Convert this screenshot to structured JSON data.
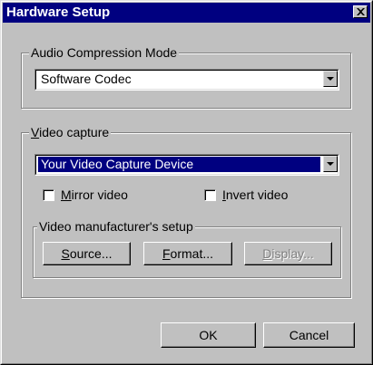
{
  "window": {
    "title": "Hardware Setup",
    "close_icon": "close-icon"
  },
  "audio": {
    "group_label": "Audio Compression Mode",
    "selected_value": "Software Codec"
  },
  "video": {
    "group_label_accel": "V",
    "group_label_rest": "ideo capture",
    "device_value": "Your Video Capture Device",
    "mirror": {
      "accel": "M",
      "rest": "irror video",
      "checked": false
    },
    "invert": {
      "accel": "I",
      "rest": "nvert video",
      "checked": false
    }
  },
  "manufacturer": {
    "group_label": "Video manufacturer's setup",
    "source": {
      "accel": "S",
      "rest": "ource..."
    },
    "format": {
      "accel": "F",
      "rest": "ormat..."
    },
    "display": {
      "accel": "D",
      "rest": "isplay...",
      "disabled": true
    }
  },
  "footer": {
    "ok_label": "OK",
    "cancel_label": "Cancel"
  }
}
